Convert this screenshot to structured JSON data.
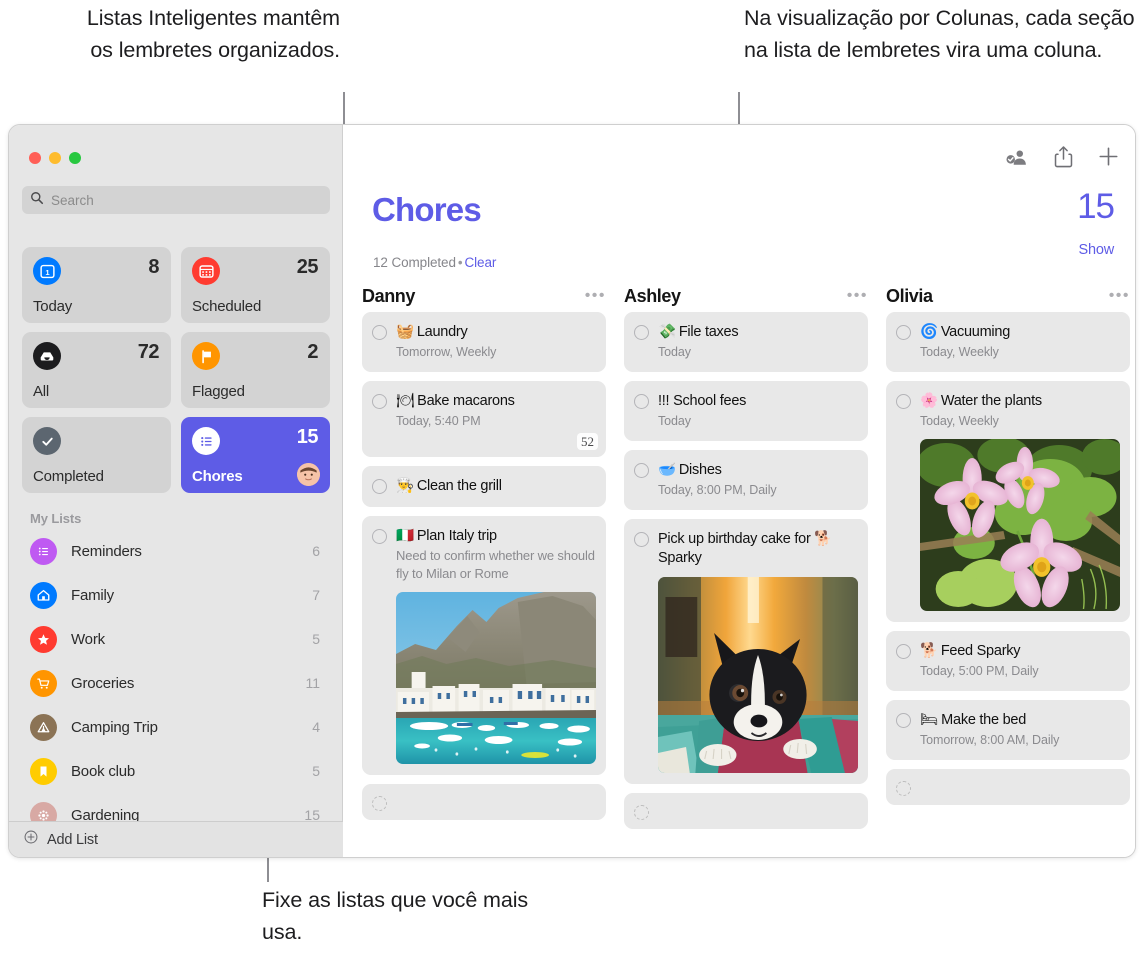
{
  "annotations": {
    "top_left": "Listas Inteligentes mantêm os lembretes organizados.",
    "top_right": "Na visualização por Colunas, cada seção na lista de lembretes vira uma coluna.",
    "bottom": "Fixe as listas que você mais usa."
  },
  "colors": {
    "accent": "#5e5ce6",
    "sidebar_bg": "#e6e6e6",
    "task_bg": "#e8e8e8",
    "muted_text": "#8a8a8e"
  },
  "window": {
    "traffic_lights": [
      "close",
      "minimize",
      "zoom"
    ]
  },
  "search": {
    "placeholder": "Search",
    "icon": "search-icon",
    "value": ""
  },
  "sidebar": {
    "smart_lists": [
      {
        "label": "Today",
        "count": "8",
        "icon": "today-calendar-icon",
        "icon_color": "#007aff",
        "glyph": "1",
        "active": false
      },
      {
        "label": "Scheduled",
        "count": "25",
        "icon": "scheduled-calendar-icon",
        "icon_color": "#ff3b30",
        "glyph": "▦",
        "active": false
      },
      {
        "label": "All",
        "count": "72",
        "icon": "inbox-tray-icon",
        "icon_color": "#1c1c1e",
        "glyph": "▭",
        "active": false
      },
      {
        "label": "Flagged",
        "count": "2",
        "icon": "flag-icon",
        "icon_color": "#ff9500",
        "glyph": "⚑",
        "active": false
      },
      {
        "label": "Completed",
        "count": "",
        "icon": "checkmark-icon",
        "icon_color": "#5c6670",
        "glyph": "✓",
        "active": false
      },
      {
        "label": "Chores",
        "count": "15",
        "icon": "list-bullet-icon",
        "icon_color": "#ffffff",
        "glyph": "≣",
        "active": true,
        "avatar": "shared-avatar"
      }
    ],
    "my_lists_header": "My Lists",
    "lists": [
      {
        "label": "Reminders",
        "count": "6",
        "icon": "list-bullet-icon",
        "color": "#bf5af2",
        "glyph": "≣"
      },
      {
        "label": "Family",
        "count": "7",
        "icon": "house-icon",
        "color": "#007aff",
        "glyph": "⌂"
      },
      {
        "label": "Work",
        "count": "5",
        "icon": "star-icon",
        "color": "#ff3b30",
        "glyph": "★"
      },
      {
        "label": "Groceries",
        "count": "11",
        "icon": "shopping-cart-icon",
        "color": "#ff9500",
        "glyph": "🛒"
      },
      {
        "label": "Camping Trip",
        "count": "4",
        "icon": "tent-icon",
        "color": "#8b7355",
        "glyph": "⛺"
      },
      {
        "label": "Book club",
        "count": "5",
        "icon": "bookmark-icon",
        "color": "#ffcc00",
        "glyph": "🔖"
      },
      {
        "label": "Gardening",
        "count": "15",
        "icon": "flower-icon",
        "color": "#d8a9a4",
        "glyph": "✽"
      }
    ],
    "add_list": {
      "label": "Add List",
      "icon": "plus-circle-icon"
    }
  },
  "toolbar": {
    "items": [
      {
        "name": "share-participants-icon",
        "label": ""
      },
      {
        "name": "share-icon",
        "label": ""
      },
      {
        "name": "add-reminder-icon",
        "label": ""
      }
    ]
  },
  "header": {
    "title": "Chores",
    "completed_text": "12 Completed",
    "separator": "•",
    "clear_label": "Clear",
    "count": "15",
    "show_label": "Show"
  },
  "columns": [
    {
      "name": "Danny",
      "menu": "•••",
      "tasks": [
        {
          "emoji": "🧺",
          "title": "Laundry",
          "meta": "Tomorrow, Weekly"
        },
        {
          "emoji": "🍽",
          "title": "Bake macarons",
          "meta": "Today, 5:40 PM",
          "badge": "52"
        },
        {
          "emoji": "👨‍🍳",
          "title": "Clean the grill",
          "meta": ""
        },
        {
          "emoji": "🇮🇹",
          "title": "Plan Italy trip",
          "note": "Need to confirm whether we should fly to Milan or Rome",
          "photo": "italy-coastal-village-photo"
        },
        {
          "emoji": "",
          "title": "",
          "meta": "",
          "empty": true
        }
      ]
    },
    {
      "name": "Ashley",
      "menu": "•••",
      "tasks": [
        {
          "emoji": "💸",
          "title": "File taxes",
          "meta": "Today"
        },
        {
          "emoji": "",
          "title": "!!! School fees",
          "meta": "Today"
        },
        {
          "emoji": "🥣",
          "title": "Dishes",
          "meta": "Today, 8:00 PM, Daily"
        },
        {
          "emoji": "",
          "title": "Pick up birthday cake for 🐕 Sparky",
          "photo": "boston-terrier-dog-photo"
        },
        {
          "emoji": "",
          "title": "",
          "meta": "",
          "empty": true
        }
      ]
    },
    {
      "name": "Olivia",
      "menu": "•••",
      "tasks": [
        {
          "emoji": "🌀",
          "title": "Vacuuming",
          "meta": "Today, Weekly"
        },
        {
          "emoji": "🌸",
          "title": "Water the plants",
          "meta": "Today, Weekly",
          "photo": "pink-cosmos-flowers-photo"
        },
        {
          "emoji": "🐕",
          "title": "Feed Sparky",
          "meta": "Today, 5:00 PM, Daily"
        },
        {
          "emoji": "🛏",
          "title": "Make the bed",
          "meta": "Tomorrow, 8:00 AM, Daily"
        },
        {
          "emoji": "",
          "title": "",
          "meta": "",
          "empty": true
        }
      ]
    }
  ]
}
